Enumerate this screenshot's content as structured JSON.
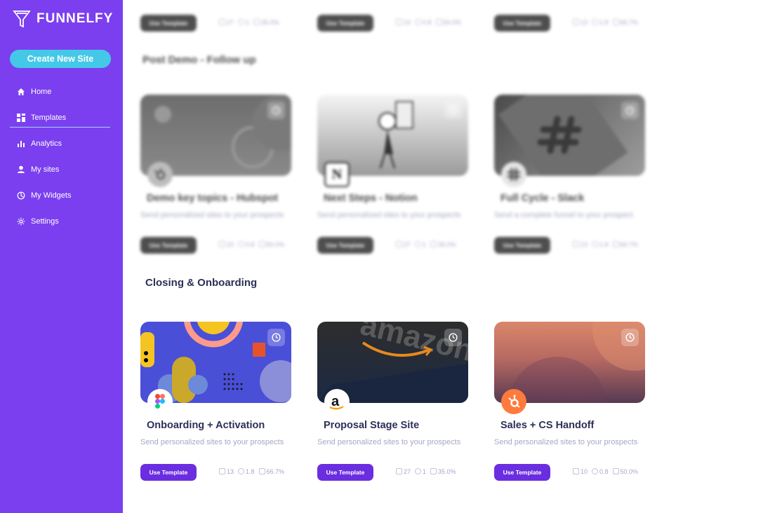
{
  "brand": {
    "name": "FUNNELFY"
  },
  "sidebar": {
    "create_label": "Create New Site",
    "items": [
      {
        "label": "Home",
        "icon": "home-icon"
      },
      {
        "label": "Templates",
        "icon": "grid-icon",
        "active": true
      },
      {
        "label": "Analytics",
        "icon": "bar-chart-icon"
      },
      {
        "label": "My sites",
        "icon": "user-icon"
      },
      {
        "label": "My Widgets",
        "icon": "widget-icon"
      },
      {
        "label": "Settings",
        "icon": "gear-icon"
      }
    ]
  },
  "top_row": [
    {
      "button": "Use Template",
      "views": "27",
      "time": "1",
      "rate": "35.0%"
    },
    {
      "button": "Use Template",
      "views": "10",
      "time": "0.8",
      "rate": "50.0%"
    },
    {
      "button": "Use Template",
      "views": "13",
      "time": "1.8",
      "rate": "66.7%"
    }
  ],
  "sections": [
    {
      "title": "Post Demo - Follow up",
      "cards": [
        {
          "title": "Demo key topics - Hubspot",
          "subtitle": "Send personalized sites to your prospects",
          "button": "Use Template",
          "views": "10",
          "time": "0.8",
          "rate": "50.0%",
          "logo": "hubspot-icon"
        },
        {
          "title": "Next Steps - Notion",
          "subtitle": "Send personalized sites to your prospects",
          "button": "Use Template",
          "views": "27",
          "time": "1",
          "rate": "35.0%",
          "logo": "notion-icon"
        },
        {
          "title": "Full Cycle - Slack",
          "subtitle": "Send a complete funnel to your prospect",
          "button": "Use Template",
          "views": "13",
          "time": "1.8",
          "rate": "66.7%",
          "logo": "slack-icon"
        }
      ]
    },
    {
      "title": "Closing & Onboarding",
      "cards": [
        {
          "title": "Onboarding + Activation",
          "subtitle": "Send personalized sites to your prospects",
          "button": "Use Template",
          "views": "13",
          "time": "1.8",
          "rate": "66.7%",
          "logo": "figma-icon"
        },
        {
          "title": "Proposal Stage Site",
          "subtitle": "Send personalized sites to your prospects",
          "button": "Use Template",
          "views": "27",
          "time": "1",
          "rate": "35.0%",
          "logo": "amazon-icon"
        },
        {
          "title": "Sales + CS Handoff",
          "subtitle": "Send personalized sites to your prospects",
          "button": "Use Template",
          "views": "10",
          "time": "0.8",
          "rate": "50.0%",
          "logo": "hubspot-icon"
        }
      ]
    }
  ],
  "colors": {
    "sidebar": "#7b3ff0",
    "create_button": "#44c8e8",
    "primary_button": "#6a2ee0",
    "title": "#2b3157",
    "muted": "#a3a8c4"
  }
}
